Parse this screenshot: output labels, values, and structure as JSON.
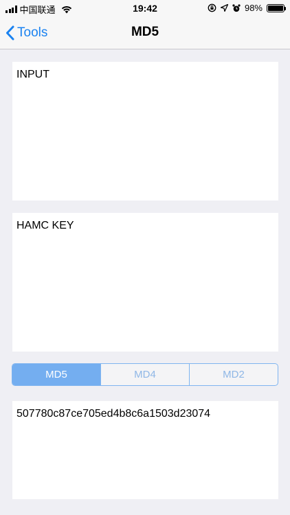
{
  "status_bar": {
    "carrier": "中国联通",
    "time": "19:42",
    "battery": "98%",
    "battery_level": 0.98,
    "icons": [
      "signal-icon",
      "wifi-icon",
      "orientation-lock-icon",
      "location-icon",
      "alarm-icon",
      "battery-icon"
    ]
  },
  "nav": {
    "back_label": "Tools",
    "title": "MD5"
  },
  "input": {
    "placeholder": "INPUT",
    "value": ""
  },
  "hmac_key": {
    "placeholder": "HAMC KEY",
    "value": ""
  },
  "algorithms": {
    "options": [
      "MD5",
      "MD4",
      "MD2"
    ],
    "selected": "MD5"
  },
  "output": {
    "value": "507780c87ce705ed4b8c6a1503d23074"
  },
  "colors": {
    "accent": "#1a82f0",
    "segment_active": "#74aef0",
    "background": "#efeff4"
  }
}
